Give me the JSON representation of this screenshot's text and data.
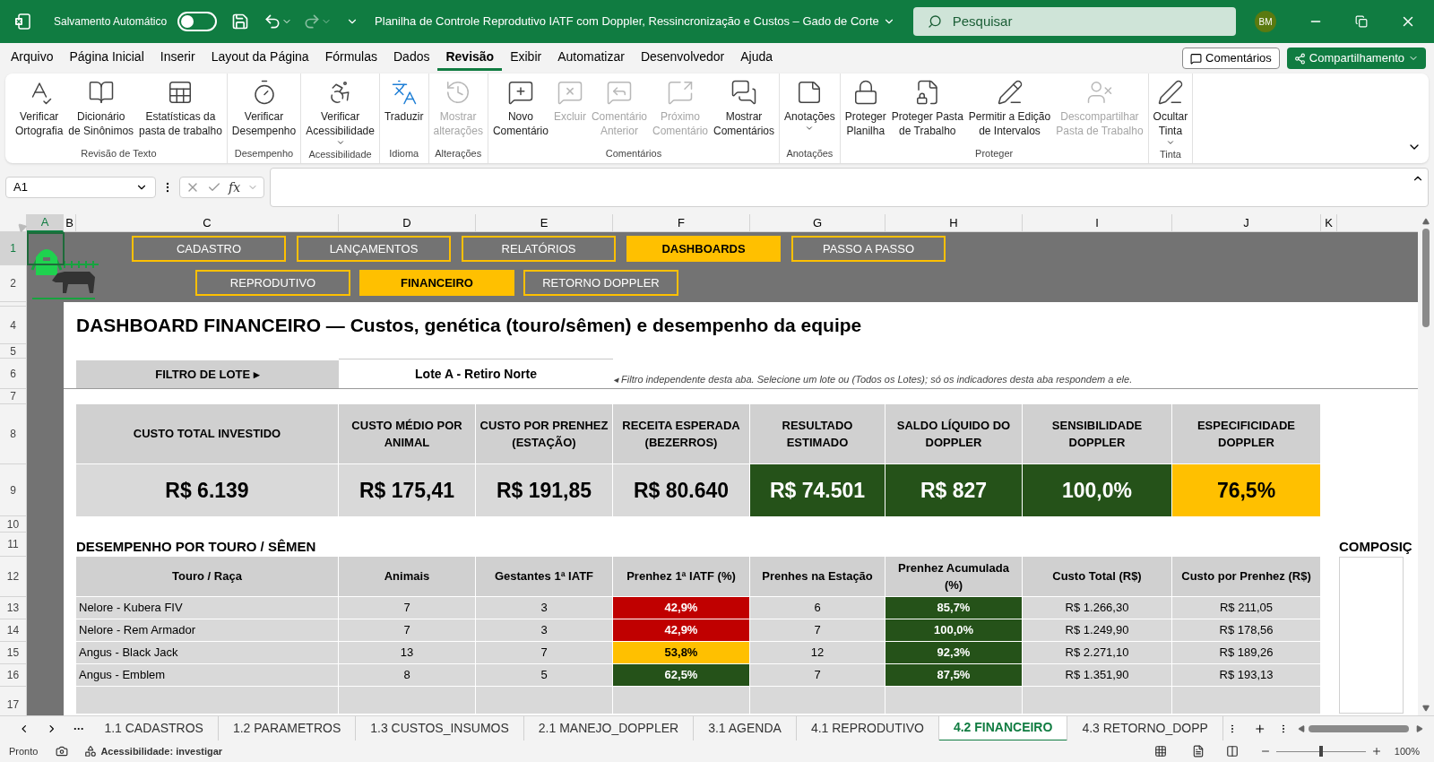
{
  "window": {
    "title": "Planilha de Controle Reprodutivo IATF com Doppler, Ressincronização e Custos – Gado de Corte",
    "autosave_label": "Salvamento Automático",
    "autosave_on": false,
    "search_placeholder": "Pesquisar",
    "user_initials": "BM"
  },
  "menu_tabs": [
    {
      "label": "Arquivo",
      "selected": false
    },
    {
      "label": "Página Inicial",
      "selected": false
    },
    {
      "label": "Inserir",
      "selected": false
    },
    {
      "label": "Layout da Página",
      "selected": false
    },
    {
      "label": "Fórmulas",
      "selected": false
    },
    {
      "label": "Dados",
      "selected": false
    },
    {
      "label": "Revisão",
      "selected": true
    },
    {
      "label": "Exibir",
      "selected": false
    },
    {
      "label": "Automatizar",
      "selected": false
    },
    {
      "label": "Desenvolvedor",
      "selected": false
    },
    {
      "label": "Ajuda",
      "selected": false
    }
  ],
  "comments_button": "Comentários",
  "share_button": "Compartilhamento",
  "ribbon_groups": [
    {
      "label": "Revisão de Texto",
      "commands": [
        {
          "label": "Verificar\nOrtografia",
          "disabled": false,
          "dropdown": false
        },
        {
          "label": "Dicionário\nde Sinônimos",
          "disabled": false,
          "dropdown": false
        },
        {
          "label": "Estatísticas da\npasta de trabalho",
          "disabled": false,
          "dropdown": false
        }
      ]
    },
    {
      "label": "Desempenho",
      "commands": [
        {
          "label": "Verificar\nDesempenho",
          "disabled": false,
          "dropdown": false
        }
      ]
    },
    {
      "label": "Acessibilidade",
      "commands": [
        {
          "label": "Verificar\nAcessibilidade",
          "disabled": false,
          "dropdown": true
        }
      ]
    },
    {
      "label": "Idioma",
      "commands": [
        {
          "label": "Traduzir",
          "disabled": false,
          "dropdown": false
        }
      ]
    },
    {
      "label": "Alterações",
      "commands": [
        {
          "label": "Mostrar\nalterações",
          "disabled": true,
          "dropdown": false
        }
      ]
    },
    {
      "label": "Comentários",
      "commands": [
        {
          "label": "Novo\nComentário",
          "disabled": false,
          "dropdown": false
        },
        {
          "label": "Excluir",
          "disabled": true,
          "dropdown": false
        },
        {
          "label": "Comentário\nAnterior",
          "disabled": true,
          "dropdown": false
        },
        {
          "label": "Próximo\nComentário",
          "disabled": true,
          "dropdown": false
        },
        {
          "label": "Mostrar\nComentários",
          "disabled": false,
          "dropdown": false
        }
      ]
    },
    {
      "label": "Anotações",
      "commands": [
        {
          "label": "Anotações",
          "disabled": false,
          "dropdown": true
        }
      ]
    },
    {
      "label": "Proteger",
      "commands": [
        {
          "label": "Proteger\nPlanilha",
          "disabled": false,
          "dropdown": false
        },
        {
          "label": "Proteger Pasta\nde Trabalho",
          "disabled": false,
          "dropdown": false
        },
        {
          "label": "Permitir a Edição\nde Intervalos",
          "disabled": false,
          "dropdown": false
        },
        {
          "label": "Descompartilhar\nPasta de Trabalho",
          "disabled": true,
          "dropdown": false
        }
      ]
    },
    {
      "label": "Tinta",
      "commands": [
        {
          "label": "Ocultar\nTinta",
          "disabled": false,
          "dropdown": true
        }
      ]
    }
  ],
  "formula_bar": {
    "name_box": "A1",
    "function_label": "fx"
  },
  "columns": [
    {
      "label": "A",
      "selected": true
    },
    {
      "label": "B",
      "selected": false
    },
    {
      "label": "C",
      "selected": false
    },
    {
      "label": "D",
      "selected": false
    },
    {
      "label": "E",
      "selected": false
    },
    {
      "label": "F",
      "selected": false
    },
    {
      "label": "G",
      "selected": false
    },
    {
      "label": "H",
      "selected": false
    },
    {
      "label": "I",
      "selected": false
    },
    {
      "label": "J",
      "selected": false
    },
    {
      "label": "K",
      "selected": false
    }
  ],
  "row_numbers": [
    "1",
    "2",
    "4",
    "5",
    "6",
    "7",
    "8",
    "9",
    "10",
    "11",
    "12",
    "13",
    "14",
    "15",
    "16",
    "17"
  ],
  "nav_main": [
    {
      "label": "CADASTRO",
      "selected": false
    },
    {
      "label": "LANÇAMENTOS",
      "selected": false
    },
    {
      "label": "RELATÓRIOS",
      "selected": false
    },
    {
      "label": "DASHBOARDS",
      "selected": true
    },
    {
      "label": "PASSO A PASSO",
      "selected": false
    }
  ],
  "nav_sub": [
    {
      "label": "REPRODUTIVO",
      "selected": false
    },
    {
      "label": "FINANCEIRO",
      "selected": true
    },
    {
      "label": "RETORNO DOPPLER",
      "selected": false
    }
  ],
  "dashboard": {
    "title": "DASHBOARD FINANCEIRO — Custos, genética (touro/sêmen) e desempenho da equipe",
    "filter_label": "FILTRO DE LOTE ▸",
    "filter_value": "Lote A - Retiro Norte",
    "filter_note": "◂ Filtro independente desta aba. Selecione um lote ou (Todos os Lotes); só os indicadores desta aba respondem a ele."
  },
  "kpis": [
    {
      "label": "CUSTO TOTAL INVESTIDO",
      "value": "R$ 6.139",
      "color": "#d9d9d9"
    },
    {
      "label": "CUSTO MÉDIO POR ANIMAL",
      "value": "R$ 175,41",
      "color": "#d9d9d9"
    },
    {
      "label": "CUSTO POR PRENHEZ (ESTAÇÃO)",
      "value": "R$ 191,85",
      "color": "#d9d9d9"
    },
    {
      "label": "RECEITA ESPERADA (BEZERROS)",
      "value": "R$ 80.640",
      "color": "#d9d9d9"
    },
    {
      "label": "RESULTADO ESTIMADO",
      "value": "R$ 74.501",
      "color": "#255219"
    },
    {
      "label": "SALDO LÍQUIDO DO DOPPLER",
      "value": "R$ 827",
      "color": "#255219"
    },
    {
      "label": "SENSIBILIDADE DOPPLER",
      "value": "100,0%",
      "color": "#255219"
    },
    {
      "label": "ESPECIFICIDADE DOPPLER",
      "value": "76,5%",
      "color": "#ffc000"
    }
  ],
  "bull_table": {
    "title": "DESEMPENHO POR TOURO / SÊMEN",
    "columns": [
      "Touro / Raça",
      "Animais",
      "Gestantes 1ª IATF",
      "Prenhez 1ª IATF (%)",
      "Prenhes na Estação",
      "Prenhez Acumulada (%)",
      "Custo Total (R$)",
      "Custo por Prenhez (R$)"
    ],
    "rows": [
      {
        "bull": "Nelore - Kubera FIV",
        "animals": "7",
        "pregnant_first": "3",
        "rate_first": {
          "value": "42,9%",
          "color": "#c00000"
        },
        "pregnant_season": "6",
        "rate_cumulative": {
          "value": "85,7%",
          "color": "#255219"
        },
        "total_cost": "R$ 1.266,30",
        "cost_per_pregnancy": "R$ 211,05"
      },
      {
        "bull": "Nelore - Rem Armador",
        "animals": "7",
        "pregnant_first": "3",
        "rate_first": {
          "value": "42,9%",
          "color": "#c00000"
        },
        "pregnant_season": "7",
        "rate_cumulative": {
          "value": "100,0%",
          "color": "#255219"
        },
        "total_cost": "R$ 1.249,90",
        "cost_per_pregnancy": "R$ 178,56"
      },
      {
        "bull": "Angus - Black Jack",
        "animals": "13",
        "pregnant_first": "7",
        "rate_first": {
          "value": "53,8%",
          "color": "#ffc000"
        },
        "pregnant_season": "12",
        "rate_cumulative": {
          "value": "92,3%",
          "color": "#255219"
        },
        "total_cost": "R$ 2.271,10",
        "cost_per_pregnancy": "R$ 189,26"
      },
      {
        "bull": "Angus - Emblem",
        "animals": "8",
        "pregnant_first": "5",
        "rate_first": {
          "value": "62,5%",
          "color": "#255219"
        },
        "pregnant_season": "7",
        "rate_cumulative": {
          "value": "87,5%",
          "color": "#255219"
        },
        "total_cost": "R$ 1.351,90",
        "cost_per_pregnancy": "R$ 193,13"
      }
    ]
  },
  "side_section_title": "COMPOSIÇ",
  "sheet_tabs": [
    {
      "label": "1.1 CADASTROS",
      "selected": false
    },
    {
      "label": "1.2 PARAMETROS",
      "selected": false
    },
    {
      "label": "1.3 CUSTOS_INSUMOS",
      "selected": false
    },
    {
      "label": "2.1 MANEJO_DOPPLER",
      "selected": false
    },
    {
      "label": "3.1 AGENDA",
      "selected": false
    },
    {
      "label": "4.1 REPRODUTIVO",
      "selected": false
    },
    {
      "label": "4.2 FINANCEIRO",
      "selected": true
    },
    {
      "label": "4.3 RETORNO_DOPP",
      "selected": false
    }
  ],
  "status_bar": {
    "ready": "Pronto",
    "accessibility": "Acessibilidade: investigar",
    "zoom": {
      "level": 0.5,
      "reading": "100%"
    }
  }
}
